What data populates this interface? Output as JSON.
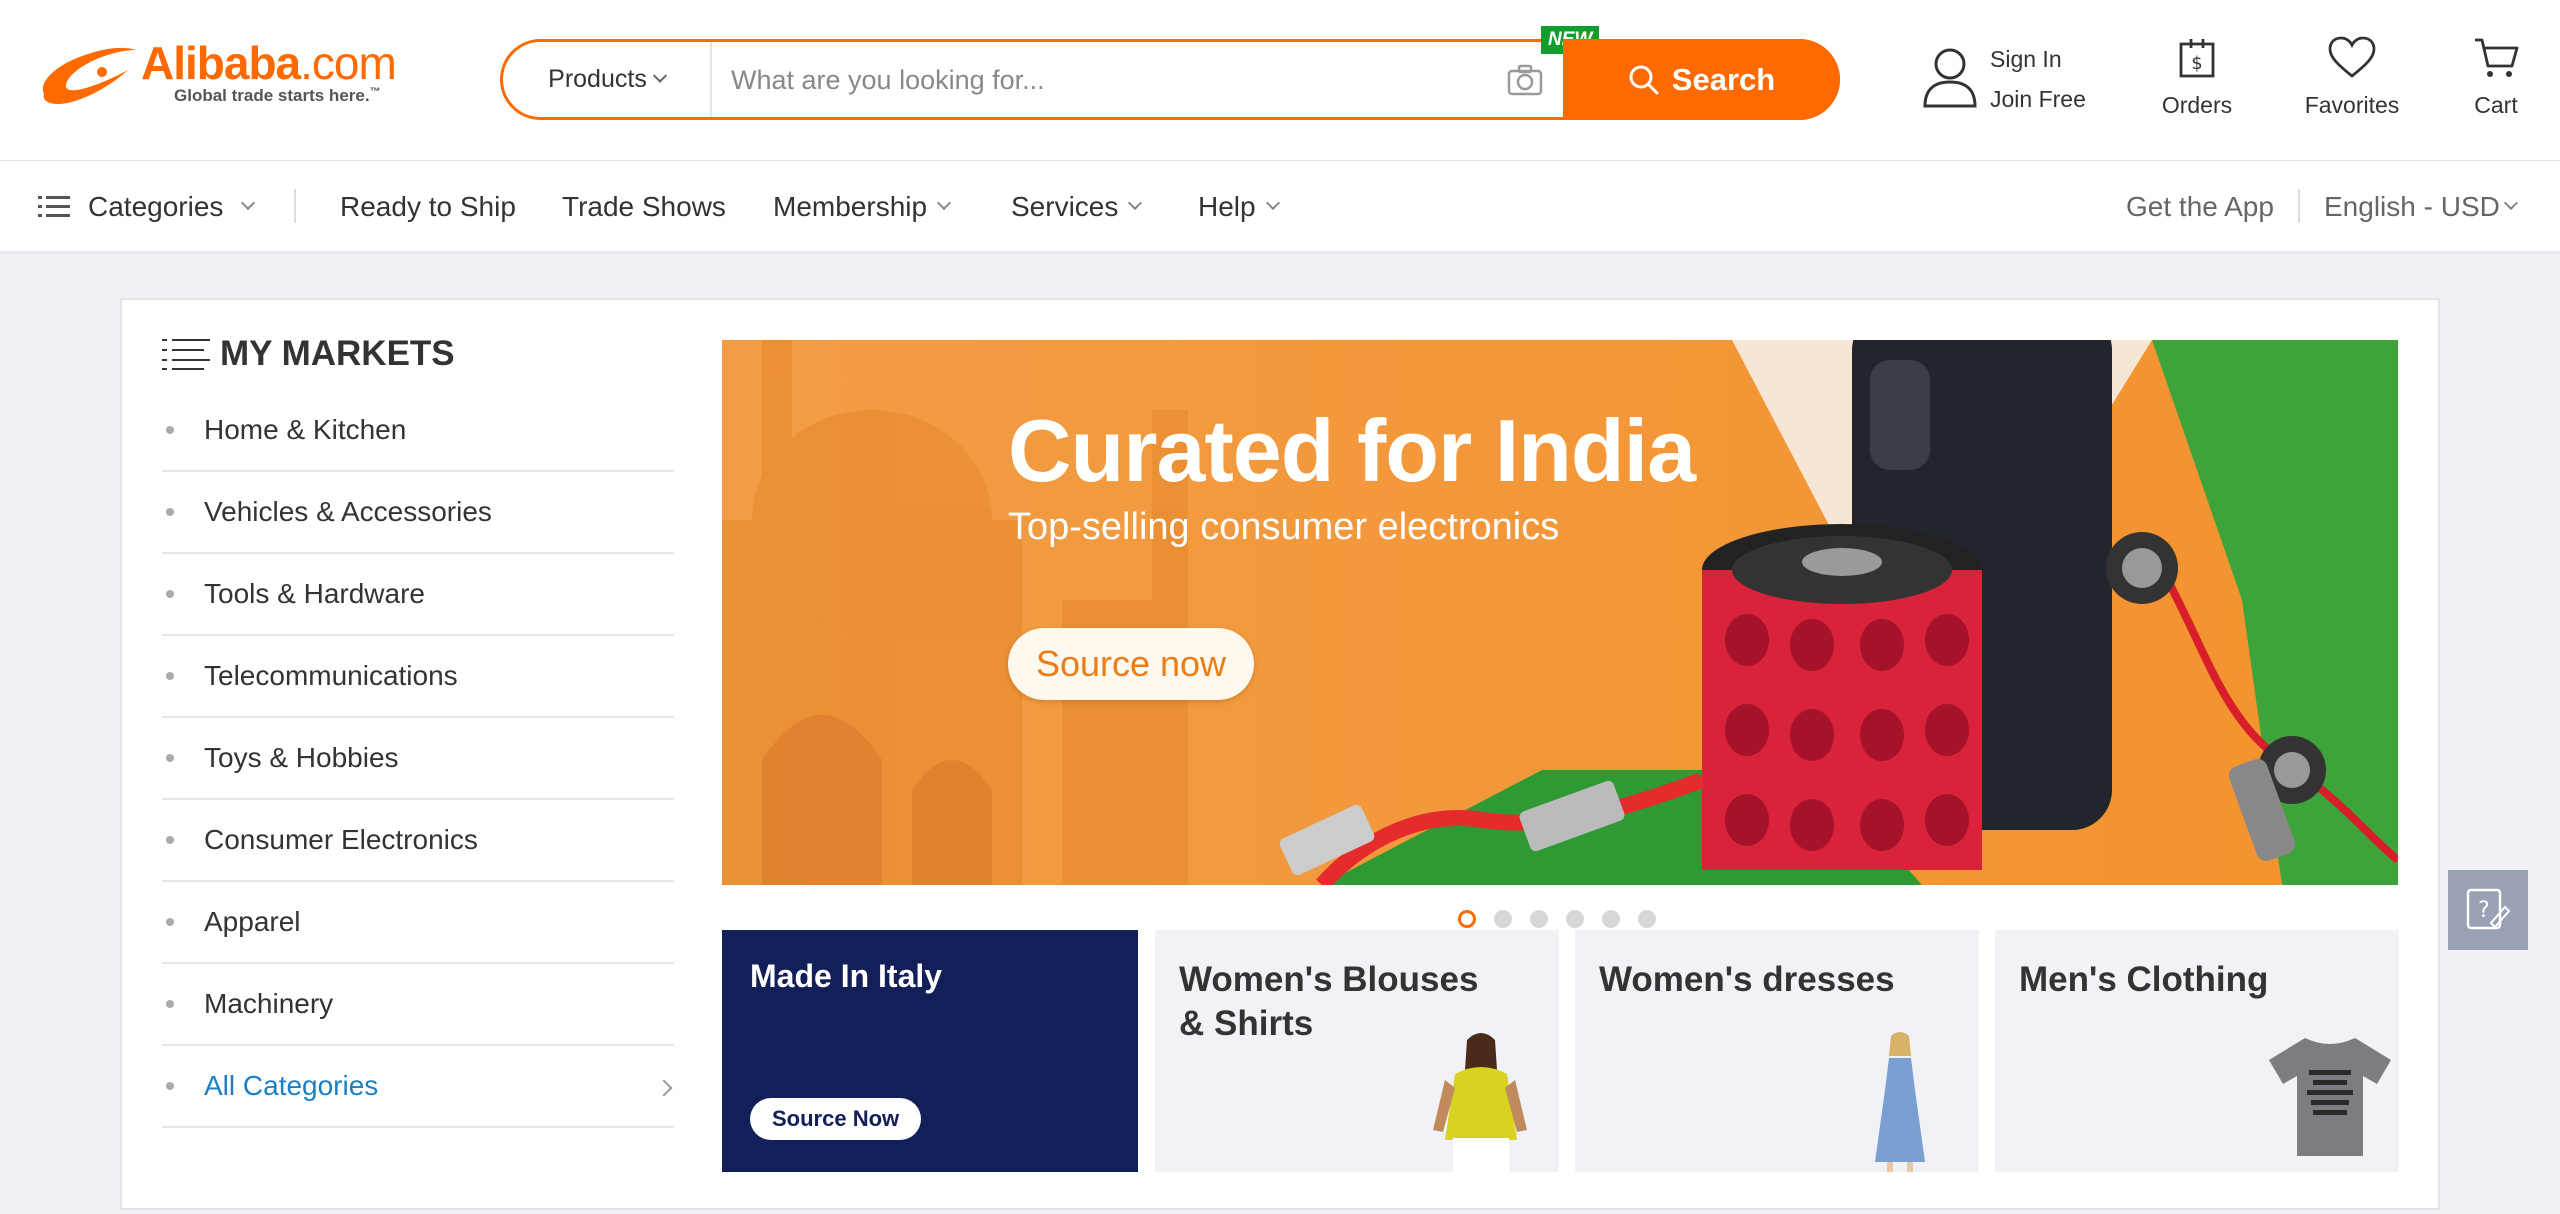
{
  "header": {
    "logo_word": "Alibaba",
    "logo_suffix": ".com",
    "tagline": "Global trade starts here.",
    "tagline_tm": "™",
    "search": {
      "category": "Products",
      "placeholder": "What are you looking for...",
      "button_label": "Search",
      "new_badge": "NEW"
    },
    "sign_in": "Sign In",
    "join_free": "Join Free",
    "orders": "Orders",
    "favorites": "Favorites",
    "cart": "Cart"
  },
  "nav": {
    "categories": "Categories",
    "items": [
      "Ready to Ship",
      "Trade Shows",
      "Membership",
      "Services",
      "Help"
    ],
    "get_app": "Get the App",
    "locale": "English - USD"
  },
  "markets": {
    "title": "MY MARKETS",
    "items": [
      "Home & Kitchen",
      "Vehicles & Accessories",
      "Tools & Hardware",
      "Telecommunications",
      "Toys & Hobbies",
      "Consumer Electronics",
      "Apparel",
      "Machinery",
      "All Categories"
    ]
  },
  "banner": {
    "headline": "Curated for India",
    "subline": "Top-selling consumer electronics",
    "cta": "Source now",
    "slide_count": 6,
    "active_slide": 1
  },
  "cards": [
    {
      "title": "Made In Italy",
      "button": "Source Now"
    },
    {
      "title": "Women's Blouses & Shirts"
    },
    {
      "title": "Women's dresses"
    },
    {
      "title": "Men's Clothing"
    }
  ],
  "colors": {
    "brand": "#ff6a00",
    "italy_card": "#131f59",
    "link": "#1a80c4",
    "new_badge": "#119e2f"
  }
}
